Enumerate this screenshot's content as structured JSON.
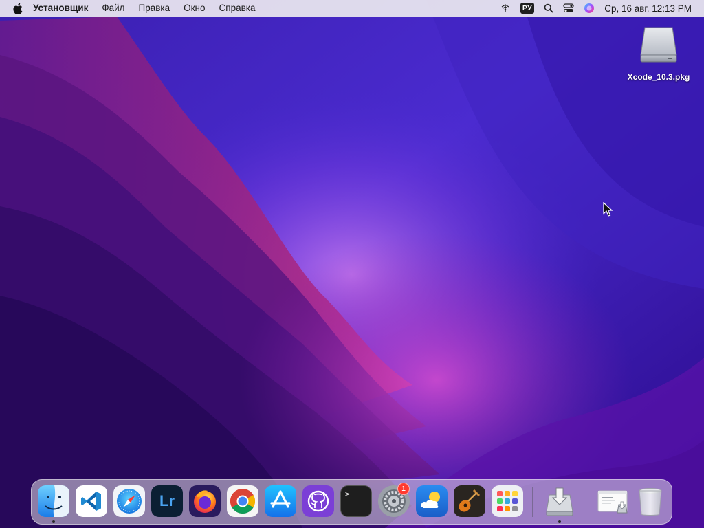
{
  "menubar": {
    "app_name": "Установщик",
    "menus": [
      "Файл",
      "Правка",
      "Окно",
      "Справка"
    ],
    "input_language": "РУ",
    "datetime": "Ср, 16 авг.  12:13 PM"
  },
  "desktop": {
    "file_label": "Xcode_10.3.pkg",
    "icon": "package-icon"
  },
  "dock": {
    "apps": [
      {
        "name": "Finder",
        "icon": "finder-icon",
        "running": true
      },
      {
        "name": "Visual Studio Code",
        "icon": "vscode-icon",
        "running": false
      },
      {
        "name": "Safari",
        "icon": "safari-icon",
        "running": false
      },
      {
        "name": "Lightroom",
        "icon": "lightroom-icon",
        "running": false,
        "text": "Lr"
      },
      {
        "name": "Firefox",
        "icon": "firefox-icon",
        "running": false
      },
      {
        "name": "Chrome",
        "icon": "chrome-icon",
        "running": false
      },
      {
        "name": "App Store",
        "icon": "app-store-icon",
        "running": false
      },
      {
        "name": "GitHub Desktop",
        "icon": "github-icon",
        "running": false
      },
      {
        "name": "Terminal",
        "icon": "terminal-icon",
        "running": false,
        "text": ">_"
      },
      {
        "name": "System Preferences",
        "icon": "settings-gear-icon",
        "running": false,
        "badge": "1"
      },
      {
        "name": "Weather",
        "icon": "weather-icon",
        "running": false
      },
      {
        "name": "GarageBand",
        "icon": "guitar-icon",
        "running": false
      },
      {
        "name": "Launchpad",
        "icon": "launchpad-grid-icon",
        "running": false
      }
    ],
    "installer": {
      "name": "Installer",
      "icon": "installer-icon",
      "running": true
    },
    "recents": [
      {
        "name": "Downloads",
        "icon": "downloads-stack-icon"
      },
      {
        "name": "Trash",
        "icon": "trash-icon"
      }
    ]
  },
  "colors": {
    "wallpaper_deep": "#2a0a7a",
    "wallpaper_mid": "#5b1fbf",
    "wallpaper_magenta": "#b0208f",
    "badge_red": "#ff3b30"
  }
}
